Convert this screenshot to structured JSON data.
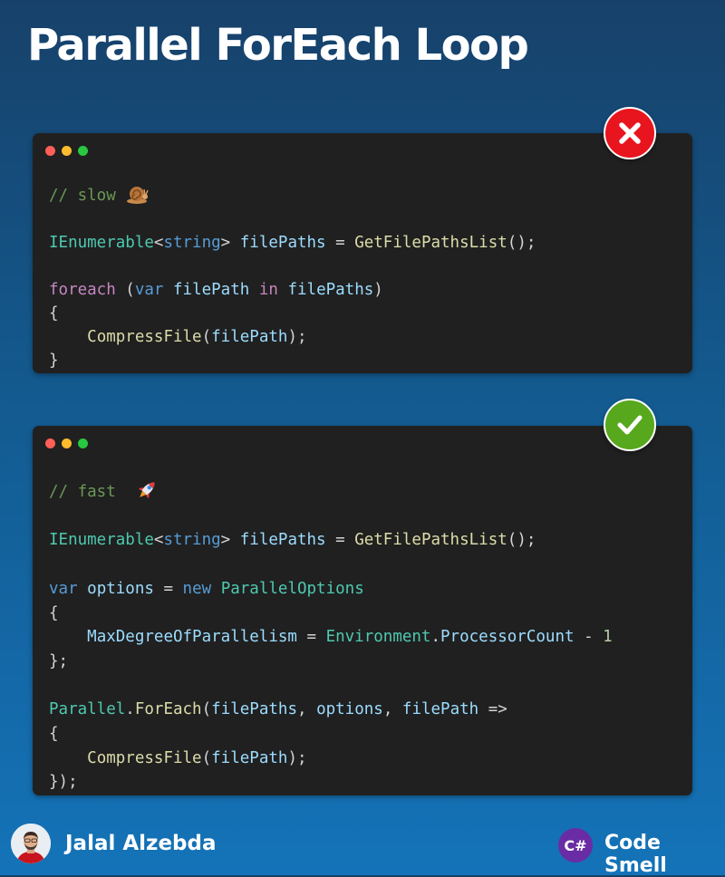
{
  "title": "Parallel ForEach Loop",
  "colors": {
    "bad": "#e8141e",
    "good": "#57a81c",
    "card_bg": "#202020"
  },
  "slow": {
    "badge_icon": "x-icon",
    "comment": "// slow",
    "comment_icon": "snail-icon",
    "line1": {
      "type": "IEnumerable",
      "lt": "<",
      "generic": "string",
      "gt": ">",
      "var": "filePaths",
      "eq": " = ",
      "fn": "GetFilePathsList",
      "end": "();"
    },
    "line2": {
      "kw": "foreach",
      "open": " (",
      "kw2": "var",
      "var1": "filePath",
      "in": "in",
      "var2": "filePaths",
      "close": ")"
    },
    "brace_open": "{",
    "line3": {
      "fn": "CompressFile",
      "open": "(",
      "arg": "filePath",
      "end": ");"
    },
    "brace_close": "}"
  },
  "fast": {
    "badge_icon": "check-icon",
    "comment": "// fast",
    "comment_icon": "rocket-icon",
    "line1": {
      "type": "IEnumerable",
      "lt": "<",
      "generic": "string",
      "gt": ">",
      "var": "filePaths",
      "eq": " = ",
      "fn": "GetFilePathsList",
      "end": "();"
    },
    "line2": {
      "kw": "var",
      "var": "options",
      "eq": " = ",
      "kw2": "new",
      "type": "ParallelOptions"
    },
    "brace_open": "{",
    "line3": {
      "prop": "MaxDegreeOfParallelism",
      "eq": " = ",
      "obj": "Environment",
      "dot": ".",
      "prop2": "ProcessorCount",
      "minus": " - ",
      "num": "1"
    },
    "brace_close_semi": "};",
    "line4": {
      "type": "Parallel",
      "dot": ".",
      "fn": "ForEach",
      "open": "(",
      "arg1": "filePaths",
      "comma1": ", ",
      "arg2": "options",
      "comma2": ", ",
      "arg3": "filePath",
      "arrow": " =>"
    },
    "brace_open2": "{",
    "line5": {
      "fn": "CompressFile",
      "open": "(",
      "arg": "filePath",
      "end": ");"
    },
    "close_all": "});"
  },
  "footer": {
    "author": "Jalal Alzebda",
    "logo_text": "C#",
    "brand": "Code Smell"
  }
}
